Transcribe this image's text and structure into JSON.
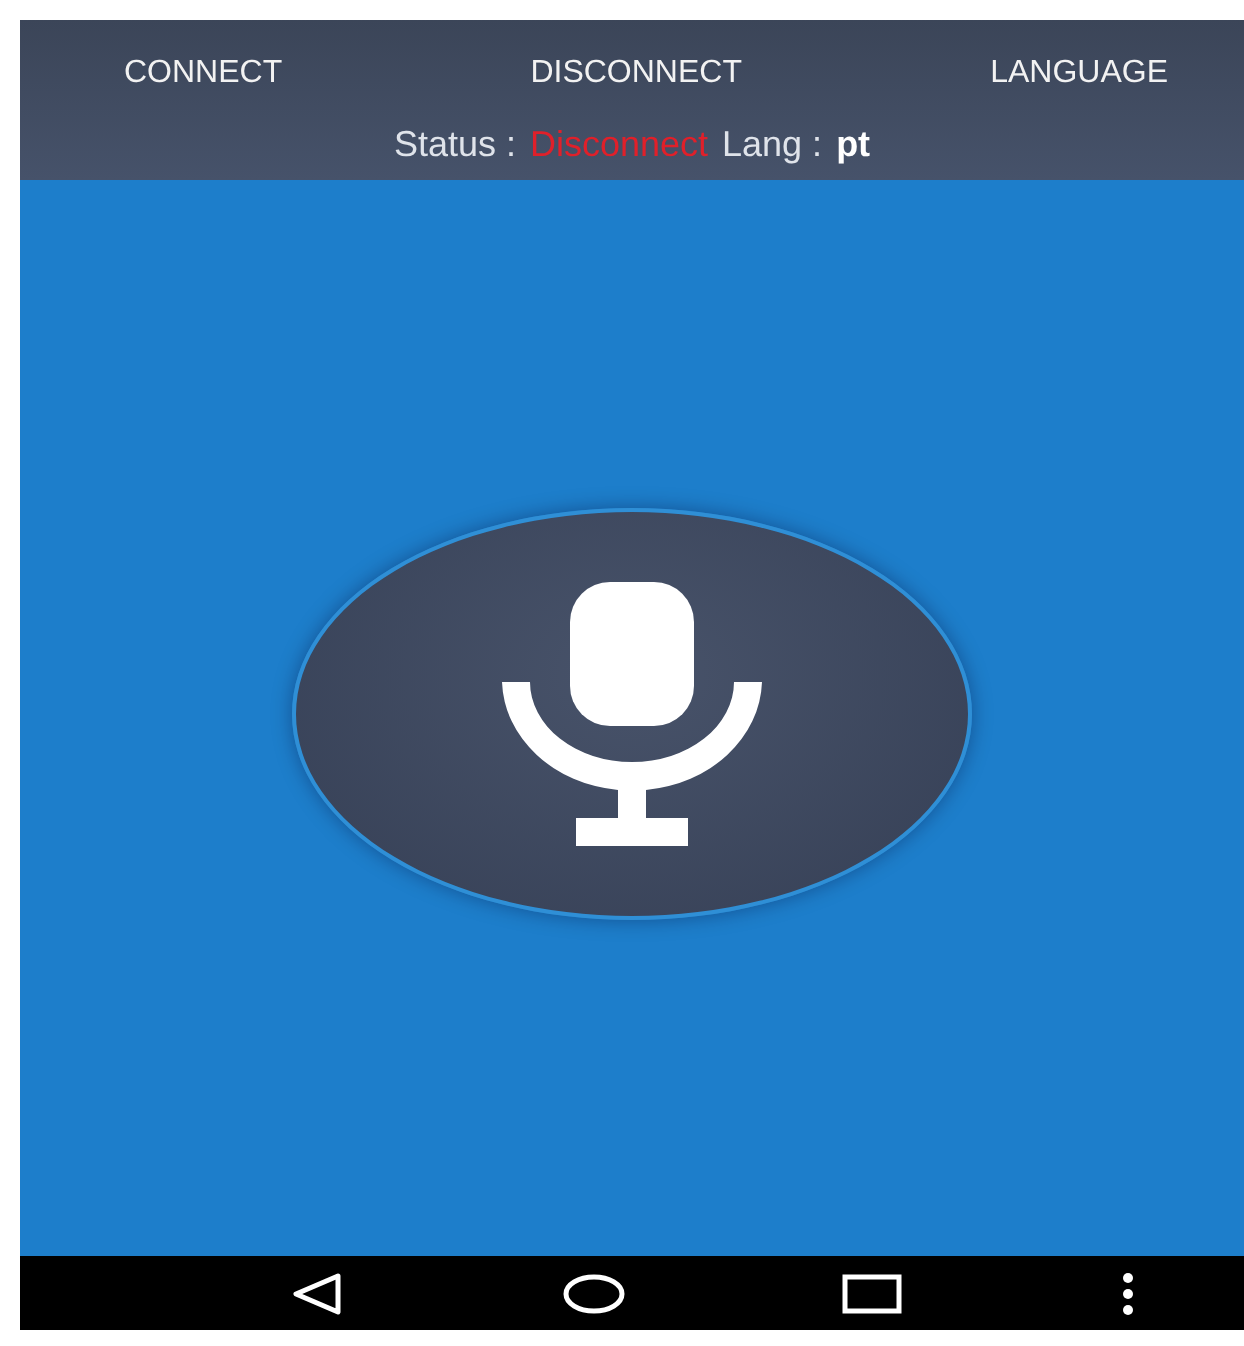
{
  "toolbar": {
    "buttons": [
      "CONNECT",
      "DISCONNECT",
      "LANGUAGE"
    ]
  },
  "status": {
    "status_label": "Status :",
    "status_value": "Disconnect",
    "lang_label": "Lang :",
    "lang_value": "pt"
  },
  "nav_bar": {
    "buttons": [
      {
        "kind": "back"
      },
      {
        "kind": "home"
      },
      {
        "kind": "recents"
      },
      {
        "kind": "menu"
      }
    ]
  }
}
